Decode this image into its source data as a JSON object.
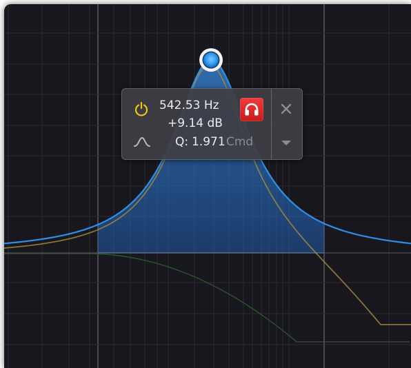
{
  "band": {
    "frequency": "542.53 Hz",
    "gain": "+9.14 dB",
    "q_label": "Q:",
    "q_value": "1.971",
    "q_modifier": "Cmd",
    "shape": "bell",
    "enabled": true,
    "solo": true
  },
  "icons": {
    "power": "power-icon",
    "shape": "bell-shape-icon",
    "solo": "headphones-icon",
    "close": "close-icon",
    "menu": "chevron-down-icon"
  },
  "colors": {
    "background": "#18171e",
    "curve": "#2f8fe8",
    "fill": "#2a6fc0",
    "band_curve": "#a88a3e",
    "secondary_curve": "#2e5a2a",
    "power_icon": "#f3c316",
    "solo_button": "#e12a2a"
  }
}
